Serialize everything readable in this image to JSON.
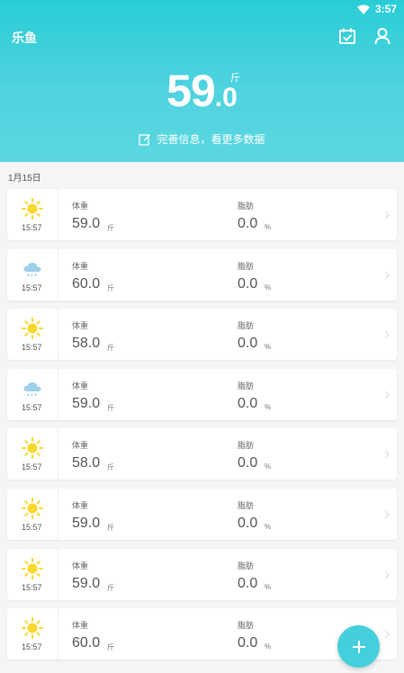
{
  "status_bar": {
    "time": "3:57",
    "wifi_icon": "wifi-icon",
    "battery_icon": "battery-icon"
  },
  "app": {
    "title": "乐鱼",
    "calendar_icon": "calendar-check-icon",
    "user_icon": "user-icon"
  },
  "summary": {
    "weight_int": "59",
    "weight_dec": ".0",
    "unit": "斤",
    "edit_text": "完善信息，看更多数据",
    "edit_icon": "edit-icon"
  },
  "date": "1月15日",
  "labels": {
    "weight": "体重",
    "fat": "脂肪",
    "weight_unit": "斤",
    "fat_unit": "%"
  },
  "records": [
    {
      "weather": "sunny",
      "time": "15:57",
      "weight": "59.0",
      "fat": "0.0"
    },
    {
      "weather": "rainy",
      "time": "15:57",
      "weight": "60.0",
      "fat": "0.0"
    },
    {
      "weather": "sunny",
      "time": "15:57",
      "weight": "58.0",
      "fat": "0.0"
    },
    {
      "weather": "rainy",
      "time": "15:57",
      "weight": "59.0",
      "fat": "0.0"
    },
    {
      "weather": "sunny",
      "time": "15:57",
      "weight": "58.0",
      "fat": "0.0"
    },
    {
      "weather": "sunny",
      "time": "15:57",
      "weight": "59.0",
      "fat": "0.0"
    },
    {
      "weather": "sunny",
      "time": "15:57",
      "weight": "59.0",
      "fat": "0.0"
    },
    {
      "weather": "sunny",
      "time": "15:57",
      "weight": "60.0",
      "fat": "0.0"
    }
  ],
  "fab_icon": "plus-icon",
  "colors": {
    "accent": "#43d0dc",
    "header": "#29cdd6",
    "sun": "#f9d82e",
    "rain": "#9fcfe9"
  }
}
